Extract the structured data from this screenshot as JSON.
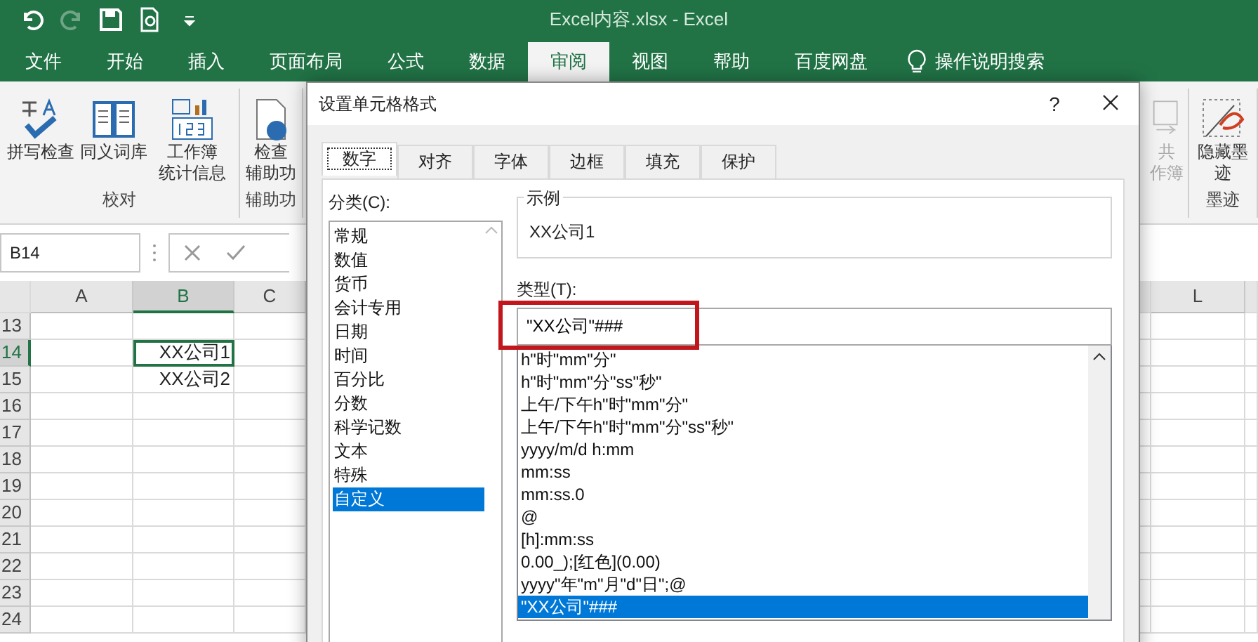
{
  "window": {
    "title": "Excel内容.xlsx  -  Excel"
  },
  "ribbon_tabs": [
    {
      "label": "文件",
      "selected": false
    },
    {
      "label": "开始",
      "selected": false
    },
    {
      "label": "插入",
      "selected": false
    },
    {
      "label": "页面布局",
      "selected": false
    },
    {
      "label": "公式",
      "selected": false
    },
    {
      "label": "数据",
      "selected": false
    },
    {
      "label": "审阅",
      "selected": true
    },
    {
      "label": "视图",
      "selected": false
    },
    {
      "label": "帮助",
      "selected": false
    },
    {
      "label": "百度网盘",
      "selected": false
    }
  ],
  "tell_me": "操作说明搜索",
  "ribbon_left_groups": [
    {
      "label": "校对",
      "buttons": [
        {
          "kind": "spell",
          "lines": [
            "拼写检查"
          ]
        },
        {
          "kind": "thesaurus",
          "lines": [
            "同义词库"
          ]
        },
        {
          "kind": "stats",
          "lines": [
            "工作簿",
            "统计信息"
          ]
        }
      ]
    },
    {
      "label": "辅助功",
      "buttons": [
        {
          "kind": "accessibility",
          "lines": [
            "检查",
            "辅助功"
          ]
        }
      ]
    }
  ],
  "ribbon_right_groups": [
    {
      "buttons": [
        {
          "kind": "share",
          "lines": [
            "共",
            "作簿"
          ],
          "disabled": true
        }
      ]
    },
    {
      "label": "墨迹",
      "buttons": [
        {
          "kind": "ink",
          "lines": [
            "隐藏墨",
            "迹"
          ],
          "disabled": false
        }
      ]
    }
  ],
  "name_box": "B14",
  "sheet": {
    "columns": [
      {
        "label": "A",
        "selected": false
      },
      {
        "label": "B",
        "selected": true
      },
      {
        "label": "C",
        "selected": false
      },
      {
        "label": "L",
        "selected": false
      }
    ],
    "rows": [
      {
        "number": "13",
        "selected": false,
        "cells": [
          "",
          "",
          "",
          ""
        ]
      },
      {
        "number": "14",
        "selected": true,
        "cells": [
          "",
          "XX公司1",
          "",
          ""
        ]
      },
      {
        "number": "15",
        "selected": false,
        "cells": [
          "",
          "XX公司2",
          "",
          ""
        ]
      },
      {
        "number": "16",
        "selected": false,
        "cells": [
          "",
          "",
          "",
          ""
        ]
      },
      {
        "number": "17",
        "selected": false,
        "cells": [
          "",
          "",
          "",
          ""
        ]
      },
      {
        "number": "18",
        "selected": false,
        "cells": [
          "",
          "",
          "",
          ""
        ]
      },
      {
        "number": "19",
        "selected": false,
        "cells": [
          "",
          "",
          "",
          ""
        ]
      },
      {
        "number": "20",
        "selected": false,
        "cells": [
          "",
          "",
          "",
          ""
        ]
      },
      {
        "number": "21",
        "selected": false,
        "cells": [
          "",
          "",
          "",
          ""
        ]
      },
      {
        "number": "22",
        "selected": false,
        "cells": [
          "",
          "",
          "",
          ""
        ]
      },
      {
        "number": "23",
        "selected": false,
        "cells": [
          "",
          "",
          "",
          ""
        ]
      },
      {
        "number": "24",
        "selected": false,
        "cells": [
          "",
          "",
          "",
          ""
        ]
      }
    ]
  },
  "dialog": {
    "title": "设置单元格格式",
    "help": "?",
    "tabs": [
      {
        "label": "数字",
        "selected": true
      },
      {
        "label": "对齐",
        "selected": false
      },
      {
        "label": "字体",
        "selected": false
      },
      {
        "label": "边框",
        "selected": false
      },
      {
        "label": "填充",
        "selected": false
      },
      {
        "label": "保护",
        "selected": false
      }
    ],
    "category_label": "分类(C):",
    "categories": [
      {
        "label": "常规",
        "selected": false
      },
      {
        "label": "数值",
        "selected": false
      },
      {
        "label": "货币",
        "selected": false
      },
      {
        "label": "会计专用",
        "selected": false
      },
      {
        "label": "日期",
        "selected": false
      },
      {
        "label": "时间",
        "selected": false
      },
      {
        "label": "百分比",
        "selected": false
      },
      {
        "label": "分数",
        "selected": false
      },
      {
        "label": "科学记数",
        "selected": false
      },
      {
        "label": "文本",
        "selected": false
      },
      {
        "label": "特殊",
        "selected": false
      },
      {
        "label": "自定义",
        "selected": true
      }
    ],
    "sample_label": "示例",
    "sample_value": "XX公司1",
    "type_label": "类型(T):",
    "type_value": "\"XX公司\"###",
    "formats": [
      {
        "label": "h\"时\"mm\"分\"",
        "selected": false
      },
      {
        "label": "h\"时\"mm\"分\"ss\"秒\"",
        "selected": false
      },
      {
        "label": "上午/下午h\"时\"mm\"分\"",
        "selected": false
      },
      {
        "label": "上午/下午h\"时\"mm\"分\"ss\"秒\"",
        "selected": false
      },
      {
        "label": "yyyy/m/d h:mm",
        "selected": false
      },
      {
        "label": "mm:ss",
        "selected": false
      },
      {
        "label": "mm:ss.0",
        "selected": false
      },
      {
        "label": "@",
        "selected": false
      },
      {
        "label": "[h]:mm:ss",
        "selected": false
      },
      {
        "label": "0.00_);[红色](0.00)",
        "selected": false
      },
      {
        "label": "yyyy\"年\"m\"月\"d\"日\";@",
        "selected": false
      },
      {
        "label": "\"XX公司\"###",
        "selected": true
      }
    ]
  }
}
